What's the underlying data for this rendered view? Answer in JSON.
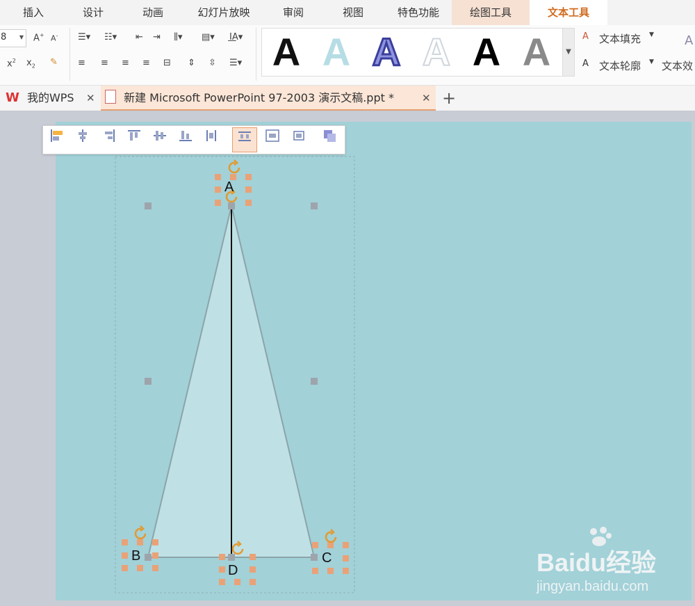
{
  "menubar": {
    "items": [
      {
        "label": "插入"
      },
      {
        "label": "设计"
      },
      {
        "label": "动画"
      },
      {
        "label": "幻灯片放映"
      },
      {
        "label": "审阅"
      },
      {
        "label": "视图"
      },
      {
        "label": "特色功能"
      },
      {
        "label": "绘图工具"
      },
      {
        "label": "文本工具"
      }
    ]
  },
  "ribbon": {
    "font_size_value": "8",
    "text_fill_label": "文本填充",
    "text_outline_label": "文本轮廓",
    "text_effect_label": "文本效",
    "styles": [
      {
        "name": "black-solid",
        "color": "#111111"
      },
      {
        "name": "light-blue",
        "color": "#b6dde5"
      },
      {
        "name": "blue-outline",
        "color": "#5a5fc0"
      },
      {
        "name": "white-outline",
        "color": "#ffffff"
      },
      {
        "name": "black-plain",
        "color": "#111111"
      },
      {
        "name": "gray-gradient",
        "color": "#777777"
      }
    ]
  },
  "tabs": [
    {
      "label": "我的WPS"
    },
    {
      "label": "新建 Microsoft PowerPoint 97-2003 演示文稿.ppt *"
    }
  ],
  "canvas": {
    "label_a": "A",
    "label_b": "B",
    "label_c": "C",
    "label_d": "D",
    "slide_color": "#a2d1d8",
    "triangle_fill": "#bfe1e6",
    "handle_color": "#e9a277"
  },
  "watermark": {
    "brand": "Baidu经验",
    "url": "jingyan.baidu.com"
  },
  "colors": {
    "accent": "#d06b1f",
    "drawing_tab_bg": "#f7e1d3"
  }
}
